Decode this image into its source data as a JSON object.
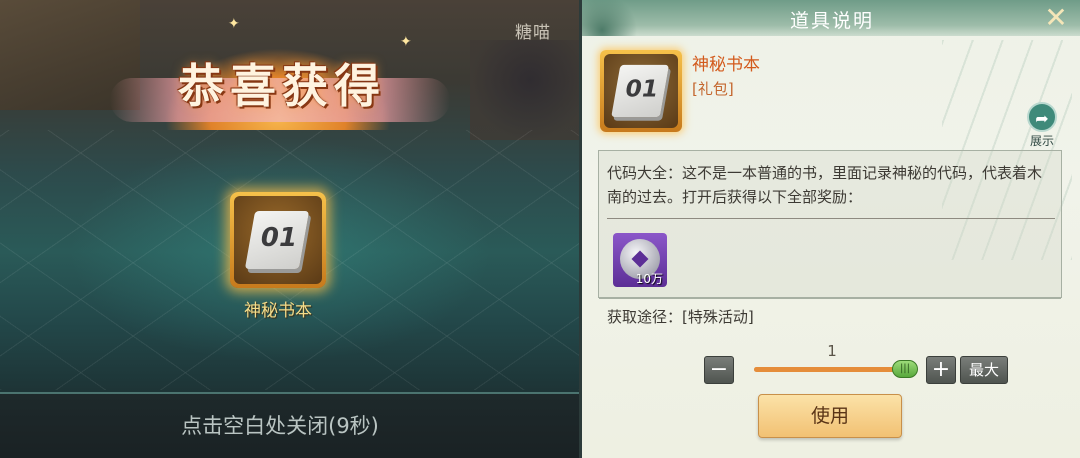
{
  "reward_popup": {
    "title": "恭喜获得",
    "npc_name": "糖喵",
    "item": {
      "number": "01",
      "name": "神秘书本"
    },
    "close_hint": "点击空白处关闭(9秒)"
  },
  "item_detail": {
    "panel_title": "道具说明",
    "close_icon": "close-icon",
    "item": {
      "number": "01",
      "name": "神秘书本",
      "type": "[礼包]"
    },
    "share_label": "展示",
    "description": "代码大全：这不是一本普通的书，里面记录神秘的代码，代表着木南的过去。打开后获得以下全部奖励：",
    "reward": {
      "icon": "silver-coin-icon",
      "quantity": "10万"
    },
    "source": "获取途径：[特殊活动]",
    "quantity_selector": {
      "value": "1",
      "minus_label": "−",
      "plus_label": "+",
      "max_label": "最大",
      "slider_level": 1.0
    },
    "use_button": "使用"
  },
  "colors": {
    "accent_gold": "#f6c14a",
    "item_name": "#d35a1c",
    "header": "#6f9c88",
    "purple_slot": "#8b57c9"
  }
}
